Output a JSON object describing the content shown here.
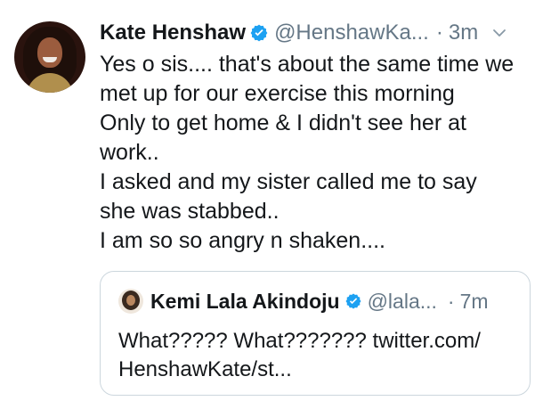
{
  "tweet": {
    "author_name": "Kate Henshaw",
    "handle": "@HenshawKa...",
    "separator": "·",
    "timestamp": "3m",
    "lines": [
      "Yes o sis.... that's about the same time we",
      "met up for our exercise this morning",
      "Only to get home & I didn't see her at",
      "work..",
      "I asked and my sister called me to say",
      "she was stabbed..",
      "I am so so angry n shaken...."
    ]
  },
  "quoted_tweet": {
    "author_name": "Kemi Lala Akindoju",
    "handle": "@lala...",
    "separator": "·",
    "timestamp": "7m",
    "lines": [
      "What????? What??????? twitter.com/",
      "HenshawKate/st..."
    ]
  },
  "icons": {
    "verified": "verified-badge-icon",
    "menu": "chevron-down-icon"
  },
  "colors": {
    "verified_blue": "#1da1f2",
    "secondary_text": "#657786",
    "primary_text": "#14171a",
    "border": "#ccd6dd"
  }
}
